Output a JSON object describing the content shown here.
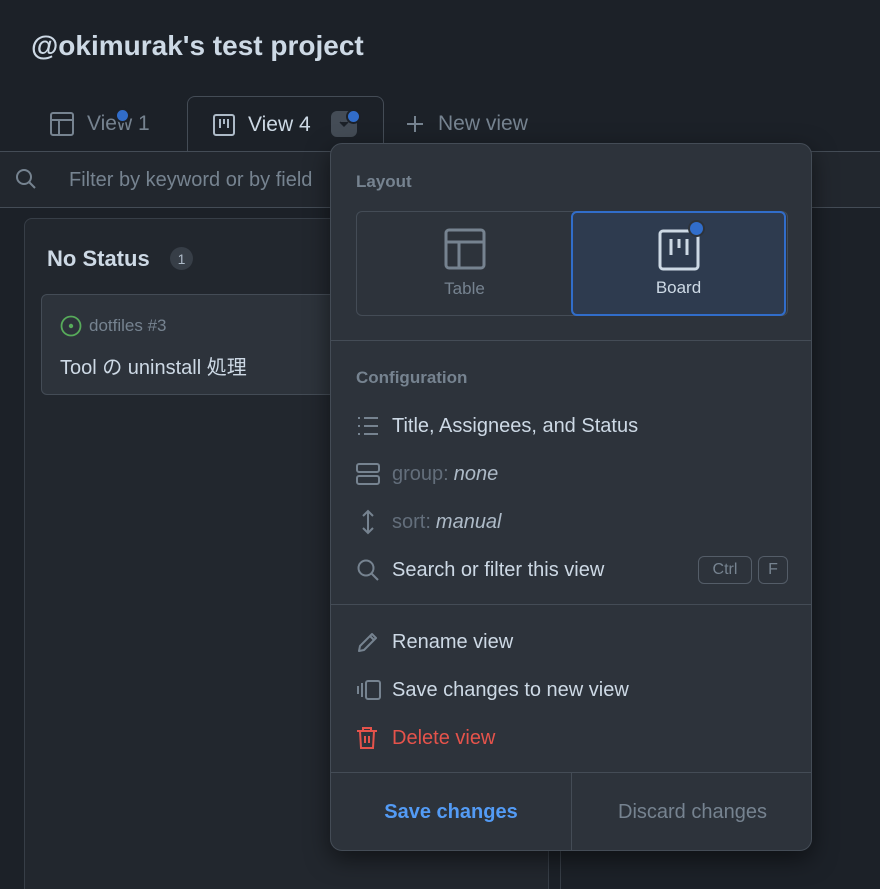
{
  "project": {
    "title": "@okimurak's test project"
  },
  "tabs": [
    {
      "label": "View 1",
      "icon": "table-icon"
    },
    {
      "label": "View 4",
      "icon": "board-icon"
    },
    {
      "label": "New view",
      "icon": "plus-icon"
    }
  ],
  "filter": {
    "placeholder": "Filter by keyword or by field"
  },
  "board": {
    "column_title": "No Status",
    "count": "1",
    "card": {
      "repo": "dotfiles #3",
      "title": "Tool の uninstall 処理"
    }
  },
  "menu": {
    "layout_label": "Layout",
    "layout_options": [
      {
        "label": "Table",
        "selected": false
      },
      {
        "label": "Board",
        "selected": true
      }
    ],
    "configuration_label": "Configuration",
    "fields": "Title, Assignees, and Status",
    "group_key": "group:",
    "group_value": "none",
    "sort_key": "sort:",
    "sort_value": "manual",
    "search": "Search or filter this view",
    "shortcut": [
      "Ctrl",
      "F"
    ],
    "rename": "Rename view",
    "save_new": "Save changes to new view",
    "delete": "Delete view",
    "save_changes": "Save changes",
    "discard_changes": "Discard changes"
  },
  "colors": {
    "accent": "#316dca",
    "link": "#539bf5",
    "danger": "#e5534b",
    "open": "#57ab5a"
  }
}
